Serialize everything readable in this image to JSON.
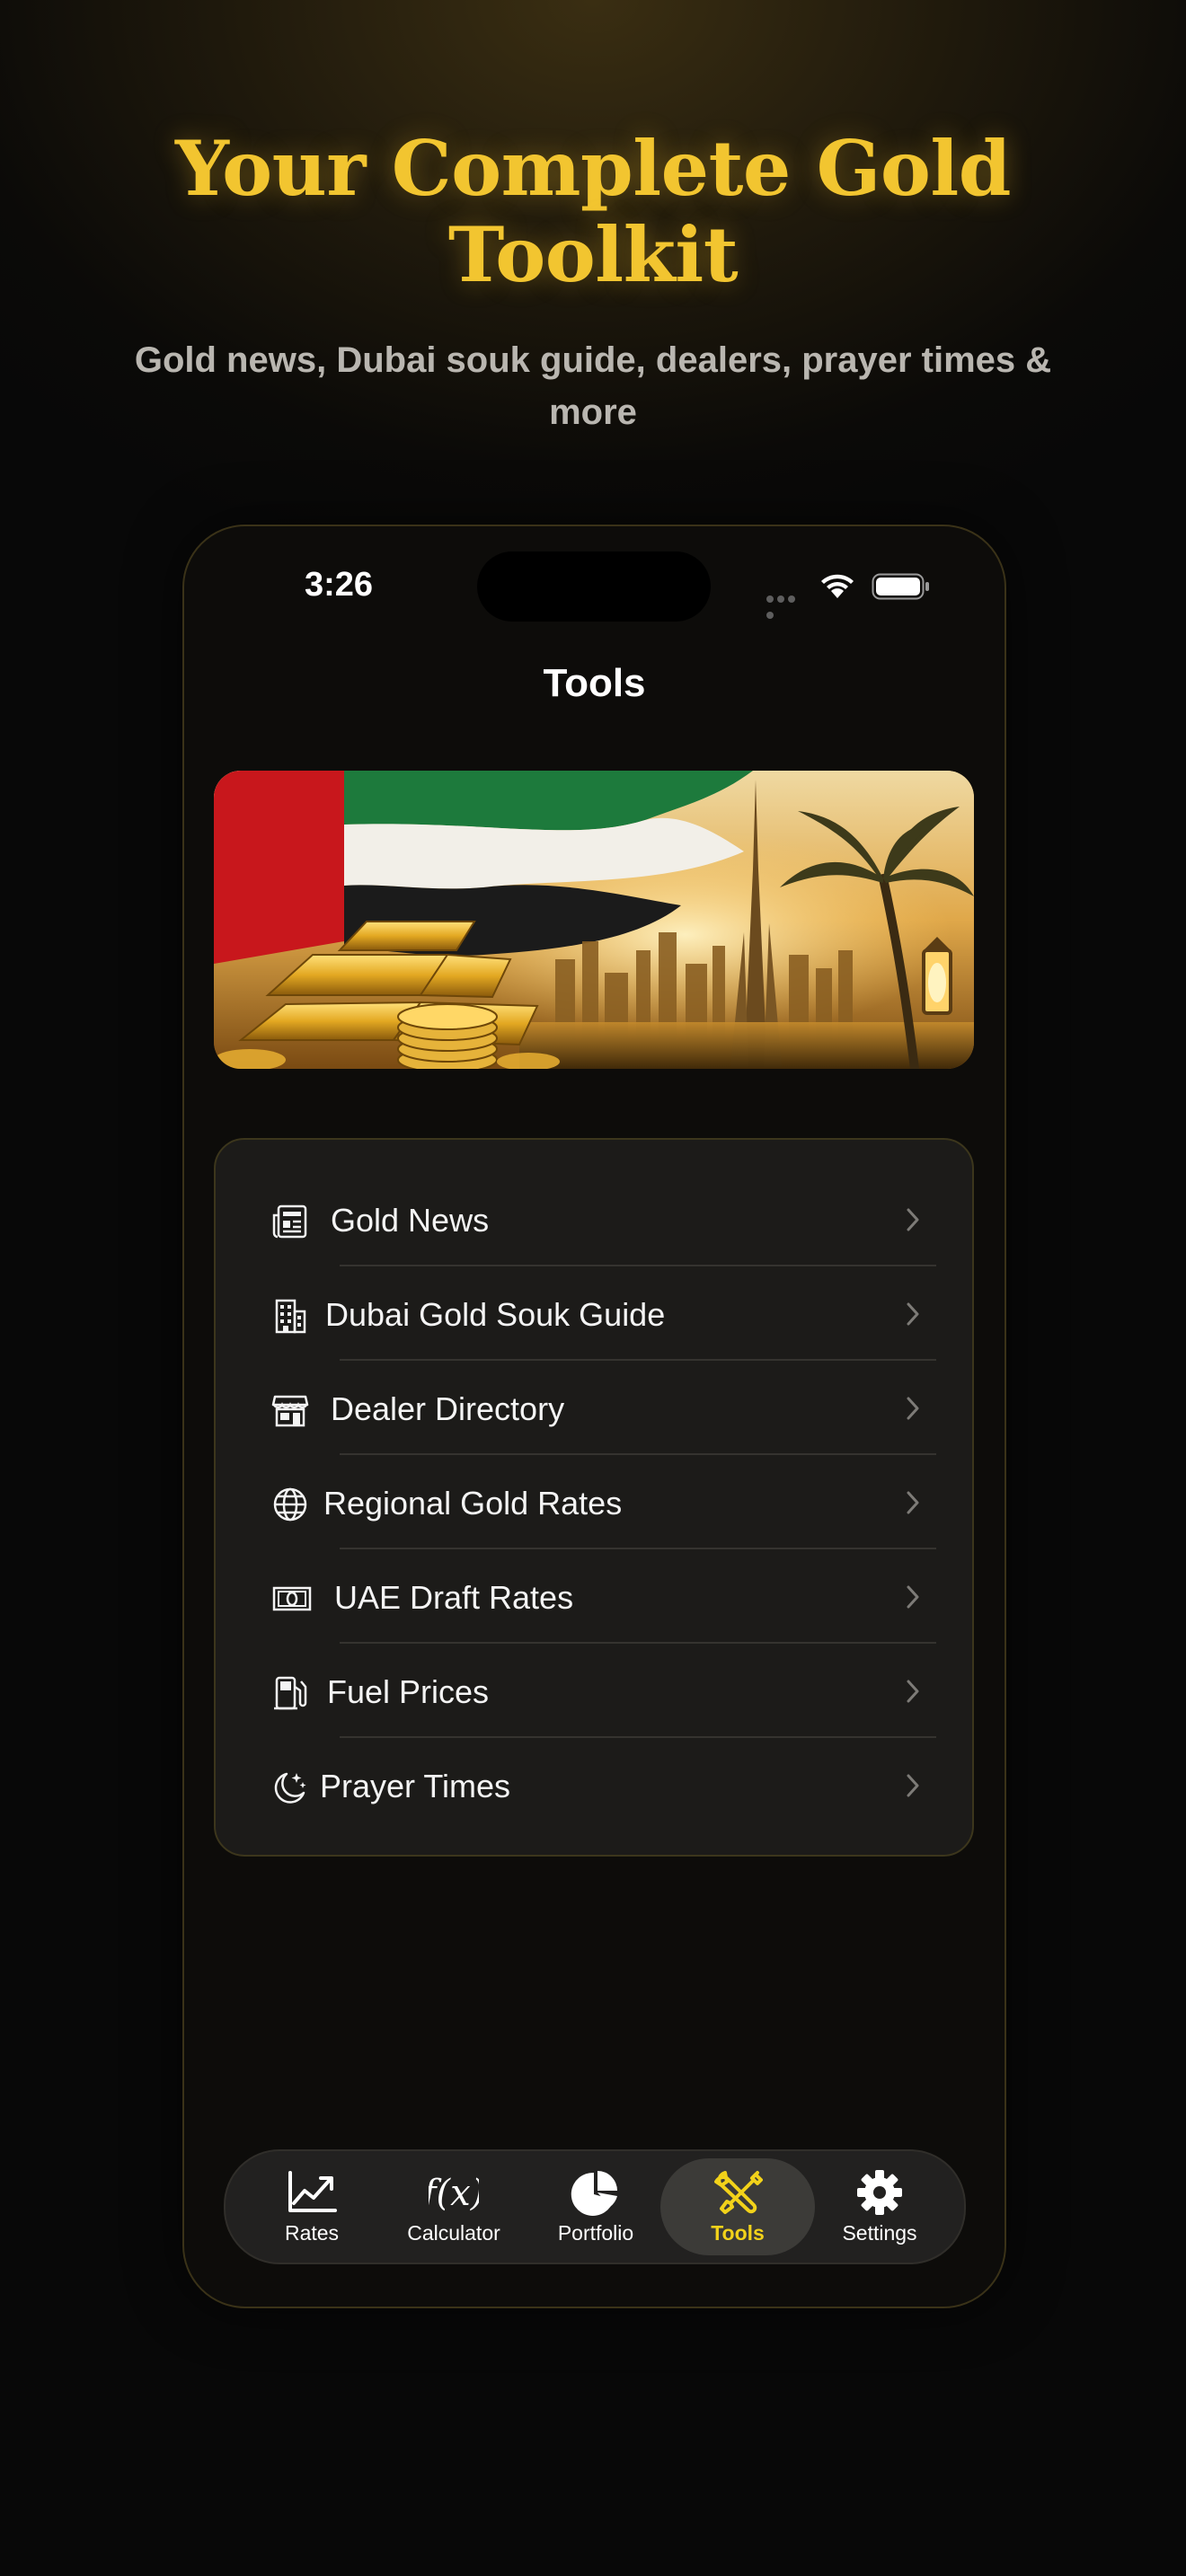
{
  "promo": {
    "headline_line1": "Your Complete Gold",
    "headline_line2": "Toolkit",
    "subheadline": "Gold news, Dubai souk guide, dealers, prayer times & more"
  },
  "status_bar": {
    "time": "3:26"
  },
  "screen": {
    "title": "Tools",
    "banner_image": "uae-flag-gold-bars-dubai-skyline"
  },
  "tools": [
    {
      "label": "Gold News",
      "icon": "newspaper-icon"
    },
    {
      "label": "Dubai Gold Souk Guide",
      "icon": "building-icon"
    },
    {
      "label": "Dealer Directory",
      "icon": "storefront-icon"
    },
    {
      "label": "Regional Gold Rates",
      "icon": "globe-icon"
    },
    {
      "label": "UAE Draft Rates",
      "icon": "banknote-icon"
    },
    {
      "label": "Fuel Prices",
      "icon": "fuel-pump-icon"
    },
    {
      "label": "Prayer Times",
      "icon": "moon-stars-icon"
    }
  ],
  "tabbar": {
    "active": "Tools",
    "active_color": "#f2d21a",
    "tabs": [
      {
        "label": "Rates",
        "icon": "chart-line-icon"
      },
      {
        "label": "Calculator",
        "icon": "function-icon"
      },
      {
        "label": "Portfolio",
        "icon": "pie-chart-icon"
      },
      {
        "label": "Tools",
        "icon": "wrench-screwdriver-icon"
      },
      {
        "label": "Settings",
        "icon": "gear-icon"
      }
    ]
  },
  "colors": {
    "accent_gold": "#f2c530",
    "background": "#0b0a08",
    "card": "#1c1b19"
  }
}
